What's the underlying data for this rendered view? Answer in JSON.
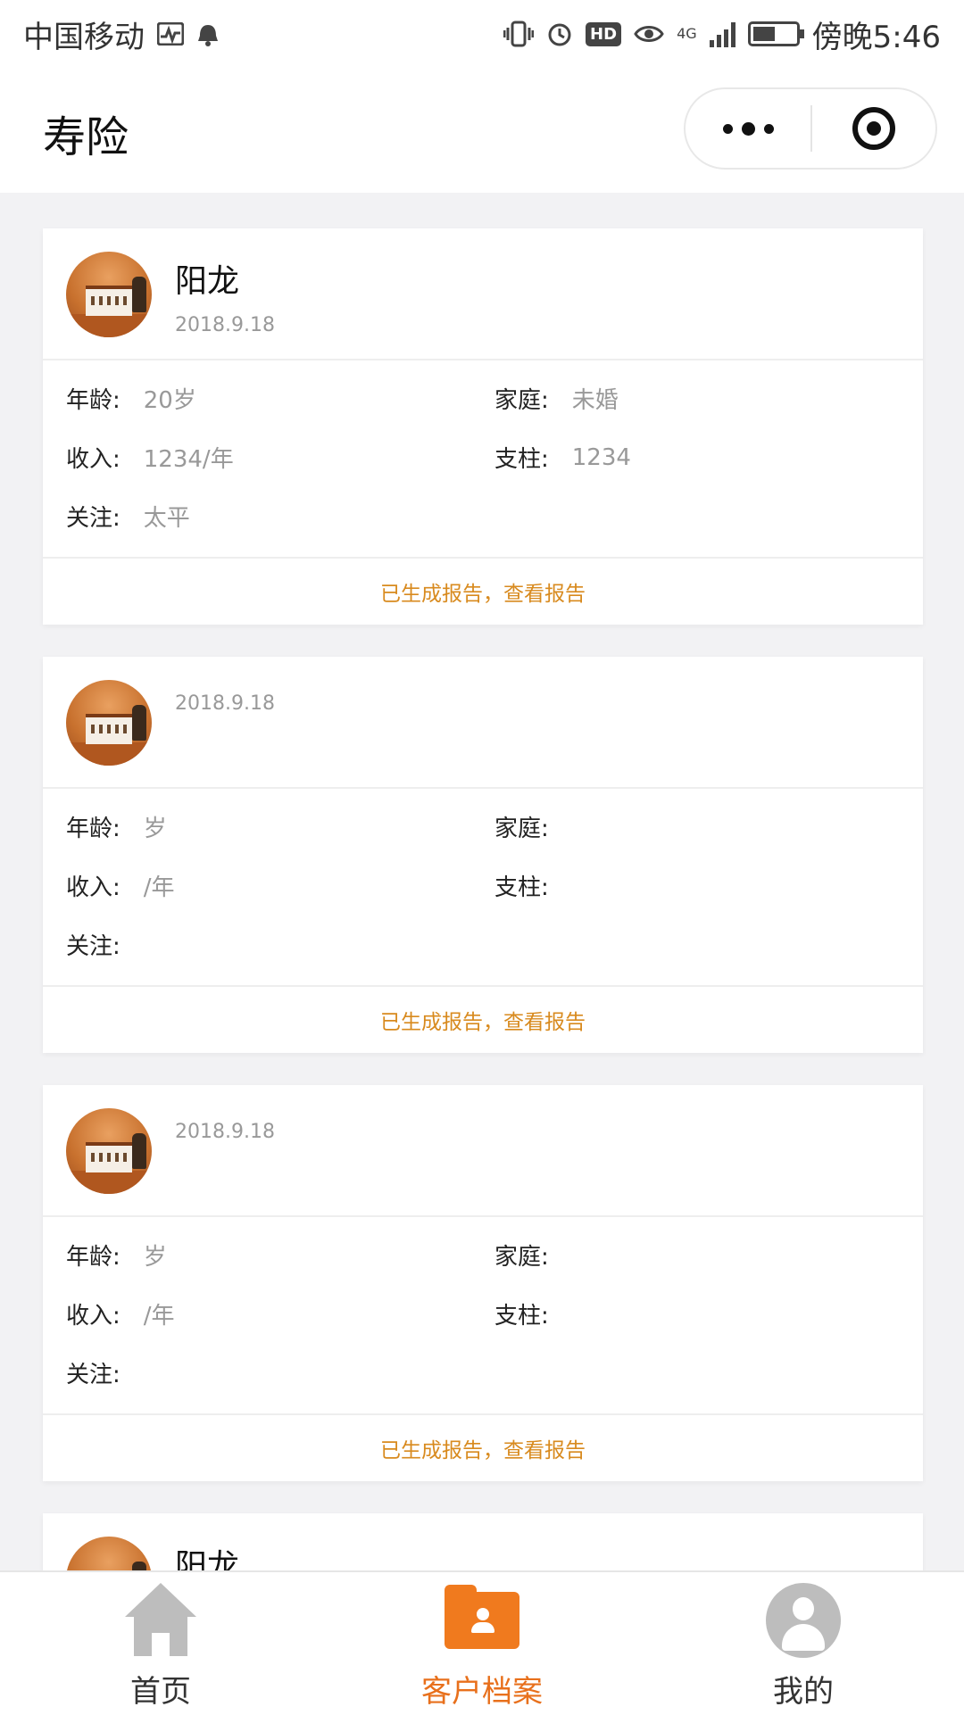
{
  "status_bar": {
    "carrier": "中国移动",
    "network": "4G",
    "hd": "HD",
    "time": "傍晚5:46"
  },
  "header": {
    "title": "寿险"
  },
  "cards": [
    {
      "name": "阳龙",
      "date": "2018.9.18",
      "age_label": "年龄:",
      "age_value": "20岁",
      "family_label": "家庭:",
      "family_value": "未婚",
      "income_label": "收入:",
      "income_value": "1234/年",
      "expense_label": "支柱:",
      "expense_value": "1234",
      "focus_label": "关注:",
      "focus_value": "太平",
      "report_link": "已生成报告，查看报告"
    },
    {
      "name": "",
      "date": "2018.9.18",
      "age_label": "年龄:",
      "age_value": "岁",
      "family_label": "家庭:",
      "family_value": "",
      "income_label": "收入:",
      "income_value": "/年",
      "expense_label": "支柱:",
      "expense_value": "",
      "focus_label": "关注:",
      "focus_value": "",
      "report_link": "已生成报告，查看报告"
    },
    {
      "name": "",
      "date": "2018.9.18",
      "age_label": "年龄:",
      "age_value": "岁",
      "family_label": "家庭:",
      "family_value": "",
      "income_label": "收入:",
      "income_value": "/年",
      "expense_label": "支柱:",
      "expense_value": "",
      "focus_label": "关注:",
      "focus_value": "",
      "report_link": "已生成报告，查看报告"
    },
    {
      "name": "阳龙"
    }
  ],
  "tab_bar": {
    "tabs": [
      {
        "label": "首页",
        "icon": "home-icon"
      },
      {
        "label": "客户档案",
        "icon": "folder-person-icon"
      },
      {
        "label": "我的",
        "icon": "user-icon"
      }
    ],
    "active_color": "#e8701c"
  },
  "colors": {
    "accent": "#f07a1e",
    "link": "#d88a1e",
    "muted": "#999999"
  }
}
